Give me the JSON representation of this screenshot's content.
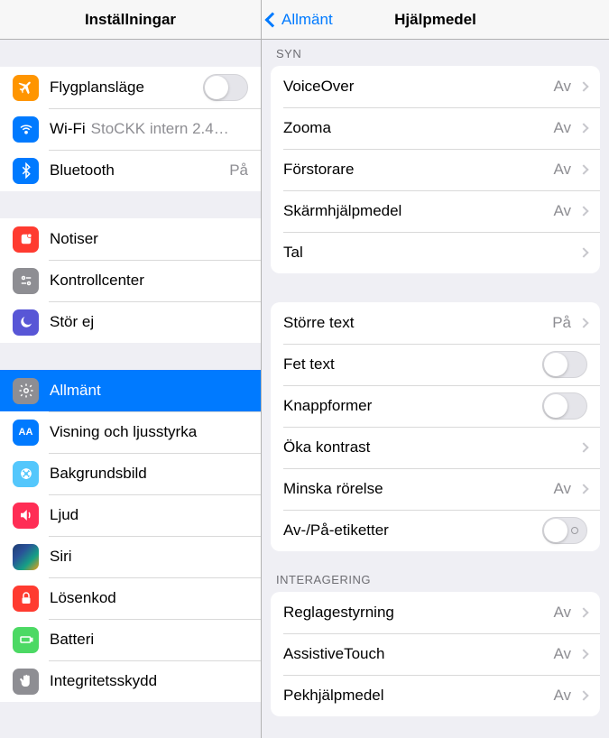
{
  "master": {
    "title": "Inställningar",
    "groups": [
      {
        "rows": [
          {
            "id": "airplane",
            "label": "Flygplansläge",
            "control": "switch",
            "switch": false
          },
          {
            "id": "wifi",
            "label": "Wi-Fi",
            "detail": "StoCKK intern 2.4…",
            "inline_detail": true
          },
          {
            "id": "bluetooth",
            "label": "Bluetooth",
            "value": "På"
          }
        ]
      },
      {
        "rows": [
          {
            "id": "notifications",
            "label": "Notiser"
          },
          {
            "id": "controlcenter",
            "label": "Kontrollcenter"
          },
          {
            "id": "dnd",
            "label": "Stör ej"
          }
        ]
      },
      {
        "rows": [
          {
            "id": "general",
            "label": "Allmänt",
            "selected": true
          },
          {
            "id": "display",
            "label": "Visning och ljusstyrka"
          },
          {
            "id": "wallpaper",
            "label": "Bakgrundsbild"
          },
          {
            "id": "sound",
            "label": "Ljud"
          },
          {
            "id": "siri",
            "label": "Siri"
          },
          {
            "id": "passcode",
            "label": "Lösenkod"
          },
          {
            "id": "battery",
            "label": "Batteri"
          },
          {
            "id": "privacy",
            "label": "Integritetsskydd"
          }
        ]
      }
    ]
  },
  "detail": {
    "back": "Allmänt",
    "title": "Hjälpmedel",
    "sections": [
      {
        "header": "SYN",
        "rows": [
          {
            "id": "voiceover",
            "label": "VoiceOver",
            "value": "Av",
            "disclosure": true
          },
          {
            "id": "zoom",
            "label": "Zooma",
            "value": "Av",
            "disclosure": true
          },
          {
            "id": "magnifier",
            "label": "Förstorare",
            "value": "Av",
            "disclosure": true
          },
          {
            "id": "display-acc",
            "label": "Skärmhjälpmedel",
            "value": "Av",
            "disclosure": true
          },
          {
            "id": "speech",
            "label": "Tal",
            "disclosure": true
          }
        ]
      },
      {
        "header": "",
        "rows": [
          {
            "id": "larger-text",
            "label": "Större text",
            "value": "På",
            "disclosure": true
          },
          {
            "id": "bold-text",
            "label": "Fet text",
            "control": "switch",
            "switch": false
          },
          {
            "id": "button-shapes",
            "label": "Knappformer",
            "control": "switch",
            "switch": false
          },
          {
            "id": "increase-contrast",
            "label": "Öka kontrast",
            "disclosure": true
          },
          {
            "id": "reduce-motion",
            "label": "Minska rörelse",
            "value": "Av",
            "disclosure": true
          },
          {
            "id": "onoff-labels",
            "label": "Av-/På-etiketter",
            "control": "switch",
            "switch": false,
            "labeled": true
          }
        ]
      },
      {
        "header": "INTERAGERING",
        "rows": [
          {
            "id": "switch-control",
            "label": "Reglagestyrning",
            "value": "Av",
            "disclosure": true
          },
          {
            "id": "assistivetouch",
            "label": "AssistiveTouch",
            "value": "Av",
            "disclosure": true
          },
          {
            "id": "touch-acc",
            "label": "Pekhjälpmedel",
            "value": "Av",
            "disclosure": true
          }
        ]
      }
    ]
  }
}
